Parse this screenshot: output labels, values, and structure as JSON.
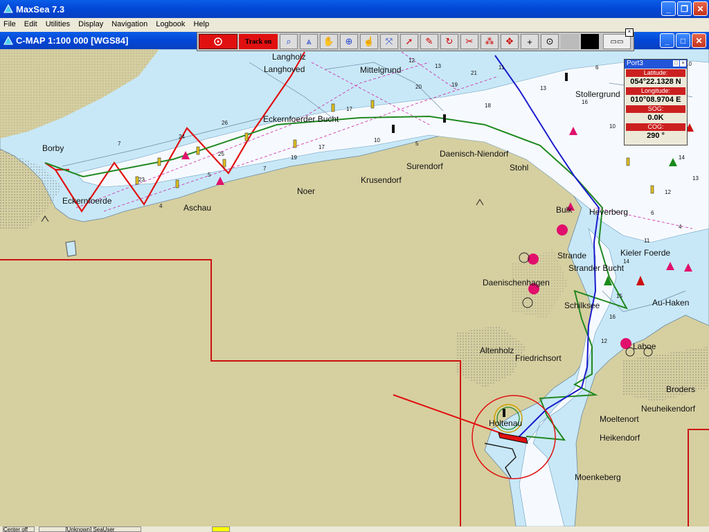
{
  "window": {
    "title": "MaxSea 7.3"
  },
  "menu": [
    "File",
    "Edit",
    "Utilities",
    "Display",
    "Navigation",
    "Logbook",
    "Help"
  ],
  "chart_window": {
    "title": "C-MAP  1:100 000 [WGS84]"
  },
  "toolbar": {
    "track_label": "Track on"
  },
  "info_panel": {
    "title": "Port3",
    "latitude_label": "Latitude:",
    "latitude": "054°22.1328 N",
    "longitude_label": "Longitude:",
    "longitude": "010°08.9704 E",
    "sog_label": "SOG:",
    "sog": "0.0K",
    "cog_label": "COG:",
    "cog": "290 °"
  },
  "places": [
    "Langholz",
    "Langhoved",
    "Mittelgrund",
    "Eckernfoerder Bucht",
    "Borby",
    "Eckernfoerde",
    "Aschau",
    "Noer",
    "Krusendorf",
    "Surendorf",
    "Daenisch-Niendorf",
    "Stohl",
    "Stollergrund",
    "Bulk",
    "Heverberg",
    "Strande",
    "Strander Bucht",
    "Kieler Foerde",
    "Daenischenhagen",
    "Schilksee",
    "Au-Haken",
    "Altenholz",
    "Friedrichsort",
    "Laboe",
    "Broders",
    "Neuheikendorf",
    "Moeltenort",
    "Heikendorf",
    "Holtenau",
    "Moenkeberg"
  ],
  "status": {
    "left": "Center off",
    "user": "[Unknown] SeaUser"
  },
  "colors": {
    "land": "#d6cfa0",
    "water": "#c8e8f8",
    "deep": "#f8fbff",
    "route_green": "#208820",
    "route_red": "#e01010",
    "track_blue": "#1a1acc",
    "magenta": "#e0106c"
  }
}
